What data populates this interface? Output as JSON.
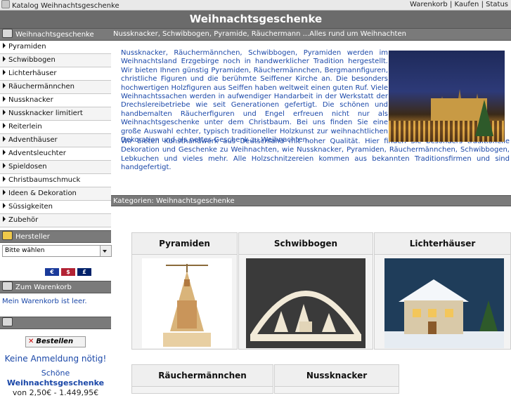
{
  "header": {
    "breadcrumb": "Katalog Weihnachtsgeschenke",
    "title": "Weihnachtsgeschenke",
    "links": [
      "Warenkorb",
      "Kaufen",
      "Status"
    ],
    "separator": "|"
  },
  "sidebar": {
    "section_title": "Weihnachtsgeschenke",
    "items": [
      {
        "label": "Pyramiden"
      },
      {
        "label": "Schwibbogen"
      },
      {
        "label": "Lichterhäuser"
      },
      {
        "label": "Räuchermännchen"
      },
      {
        "label": "Nussknacker"
      },
      {
        "label": "Nussknacker limitiert"
      },
      {
        "label": "Reiterlein"
      },
      {
        "label": "Adventhäuser"
      },
      {
        "label": "Adventsleuchter"
      },
      {
        "label": "Spieldosen"
      },
      {
        "label": "Christbaumschmuck"
      },
      {
        "label": "Ideen & Dekoration"
      },
      {
        "label": "Süssigkeiten"
      },
      {
        "label": "Zubehör"
      }
    ],
    "hersteller_title": "Hersteller",
    "hersteller_select": "Bitte wählen",
    "currencies": [
      "€",
      "$",
      "£"
    ],
    "warenkorb_title": "Zum Warenkorb",
    "warenkorb_text": "Mein Warenkorb ist leer.",
    "bestellen_label": "Bestellen",
    "no_login": "Keine Anmeldung nötig!",
    "promo_prefix": "Schöne",
    "promo_bold": "Weihnachtsgeschenke",
    "promo_price": "von 2,50€ - 1.449,95€"
  },
  "main": {
    "subtitle": "Nussknacker, Schwibbogen, Pyramide, Räuchermann ...Alles rund um Weihnachten",
    "intro": "Nussknacker, Räuchermännchen, Schwibbogen, Pyramiden werden im Weihnachtsland Erzgebirge noch in handwerklicher Tradition hergestellt. Wir bieten Ihnen günstig Pyramiden, Räuchermännchen, Bergmannfiguren, christliche Figuren und die berühmte Seiffener Kirche an. Die besonders hochwertigen Holzfiguren aus Seiffen haben weltweit einen guten Ruf. Viele Weihnachtssachen werden in aufwendiger Handarbeit in der Werkstatt der Drechslereibetriebe wie seit Generationen gefertigt. Die schönen und handbemalten Räucherfiguren und Engel erfreuen nicht nur als Weihnachtsgeschenke unter dem Christbaum. Bei uns finden Sie eine große Auswahl echter, typisch traditioneller Holzkunst zur weihnachtlichen Dekoration und als nettes Geschenk zu Weihnachten.",
    "intro2": "Wir bieten Kunsthandwerk aus Deutschland mit hoher Qualität. Hier finden Sie besonders traditionelle Dekoration und Geschenke zu Weihnachten, wie Nussknacker, Pyramiden, Räuchermännchen, Schwibbogen, Lebkuchen und vieles mehr. Alle Holzschnitzereien kommen aus bekannten Traditionsfirmen und sind handgefertigt.",
    "categories_title": "Kategorien: Weihnachtsgeschenke",
    "categories": [
      {
        "label": "Pyramiden"
      },
      {
        "label": "Schwibbogen"
      },
      {
        "label": "Lichterhäuser"
      },
      {
        "label": "Räuchermännchen"
      },
      {
        "label": "Nussknacker"
      }
    ]
  }
}
